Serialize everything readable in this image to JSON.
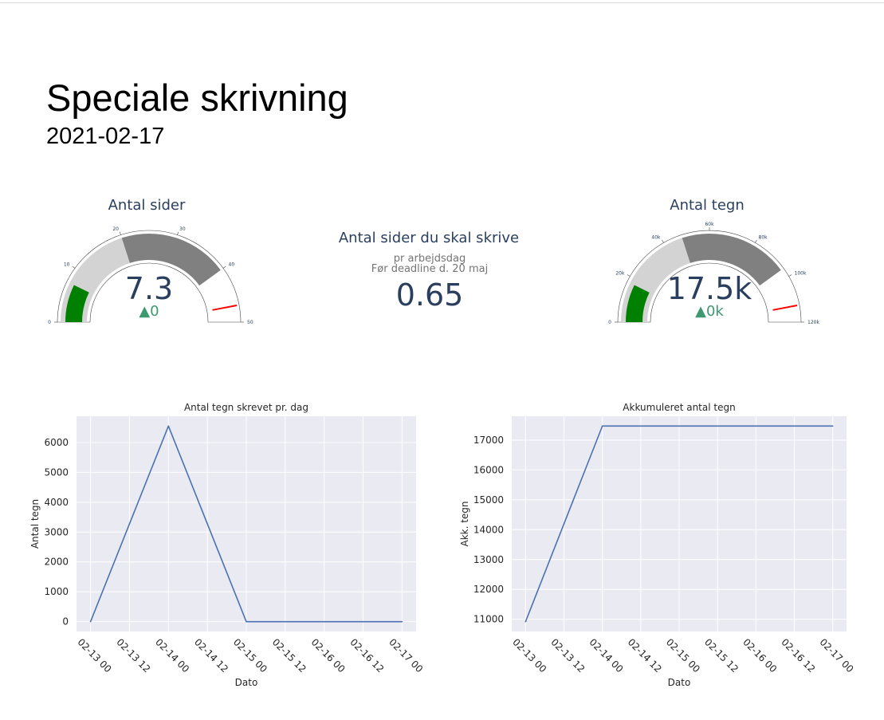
{
  "header": {
    "title": "Speciale skrivning",
    "date": "2021-02-17"
  },
  "gauges": [
    {
      "title": "Antal sider",
      "value": "7.3",
      "delta": "▲0",
      "value_num": 7.3,
      "range": [
        0,
        50
      ],
      "bands": [
        {
          "from": 0,
          "to": 20,
          "color": "#d3d3d3"
        },
        {
          "from": 20,
          "to": 40,
          "color": "#808080"
        }
      ],
      "bar_color": "#008000",
      "threshold": 47,
      "tick_values": [
        0,
        10,
        20,
        30,
        40,
        50
      ],
      "tick_labels": [
        "0",
        "10",
        "20",
        "30",
        "40",
        "50"
      ]
    },
    {
      "title": "Antal tegn",
      "value": "17.5k",
      "delta": "▲0k",
      "value_num": 17500,
      "range": [
        0,
        120000
      ],
      "bands": [
        {
          "from": 0,
          "to": 48000,
          "color": "#d3d3d3"
        },
        {
          "from": 48000,
          "to": 96000,
          "color": "#808080"
        }
      ],
      "bar_color": "#008000",
      "threshold": 112800,
      "tick_values": [
        0,
        20000,
        40000,
        60000,
        80000,
        100000,
        120000
      ],
      "tick_labels": [
        "0",
        "20k",
        "40k",
        "60k",
        "80k",
        "100k",
        "120k"
      ]
    }
  ],
  "indicator": {
    "title": "Antal sider du skal skrive",
    "subtitle_1": "pr arbejdsdag",
    "subtitle_2": "Før deadline d. 20 maj",
    "value": "0.65"
  },
  "chart_data": [
    {
      "type": "line",
      "title": "Antal tegn skrevet pr. dag",
      "xlabel": "Dato",
      "ylabel": "Antal tegn",
      "x": [
        "2021-02-13 00:00",
        "2021-02-14 00:00",
        "2021-02-15 00:00",
        "2021-02-16 00:00",
        "2021-02-17 00:00"
      ],
      "y": [
        0,
        6550,
        0,
        0,
        0
      ],
      "x_tick_labels": [
        "02-13 00",
        "02-13 12",
        "02-14 00",
        "02-14 12",
        "02-15 00",
        "02-15 12",
        "02-16 00",
        "02-16 12",
        "02-17 00"
      ],
      "y_ticks": [
        0,
        1000,
        2000,
        3000,
        4000,
        5000,
        6000
      ],
      "ylim": [
        -330,
        6880
      ],
      "grid": true,
      "line_color": "#4c72b0",
      "background": "#eaeaf2"
    },
    {
      "type": "line",
      "title": "Akkumuleret antal tegn",
      "xlabel": "Dato",
      "ylabel": "Akk. tegn",
      "x": [
        "2021-02-13 00:00",
        "2021-02-14 00:00",
        "2021-02-15 00:00",
        "2021-02-16 00:00",
        "2021-02-17 00:00"
      ],
      "y": [
        10920,
        17470,
        17470,
        17470,
        17470
      ],
      "x_tick_labels": [
        "02-13 00",
        "02-13 12",
        "02-14 00",
        "02-14 12",
        "02-15 00",
        "02-15 12",
        "02-16 00",
        "02-16 12",
        "02-17 00"
      ],
      "y_ticks": [
        11000,
        12000,
        13000,
        14000,
        15000,
        16000,
        17000
      ],
      "ylim": [
        10590,
        17800
      ],
      "grid": true,
      "line_color": "#4c72b0",
      "background": "#eaeaf2"
    }
  ]
}
